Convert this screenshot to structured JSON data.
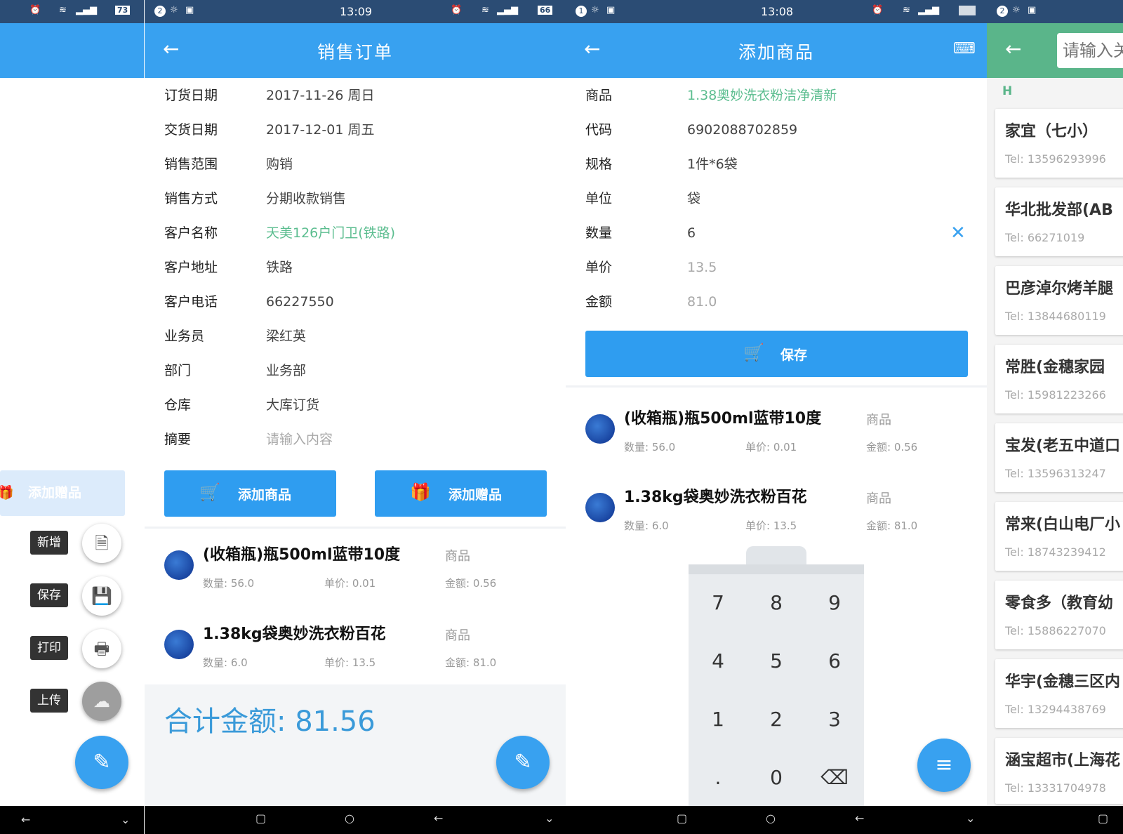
{
  "status": {
    "p1_battery": "73",
    "p2_notif": "2",
    "p2_time": "13:09",
    "p2_battery": "66",
    "p3_notif": "1",
    "p3_time": "13:08",
    "p4_notif": "2"
  },
  "p1": {
    "add_gift_ghost": "添加赠品",
    "fab_menu": [
      {
        "label": "新增",
        "icon": "new-document-icon"
      },
      {
        "label": "保存",
        "icon": "save-icon"
      },
      {
        "label": "打印",
        "icon": "print-icon"
      },
      {
        "label": "上传",
        "icon": "cloud-upload-icon"
      }
    ]
  },
  "p2": {
    "title": "销售订单",
    "fields": [
      {
        "label": "订货日期",
        "value": "2017-11-26 周日"
      },
      {
        "label": "交货日期",
        "value": "2017-12-01 周五"
      },
      {
        "label": "销售范围",
        "value": "购销"
      },
      {
        "label": "销售方式",
        "value": "分期收款销售"
      },
      {
        "label": "客户名称",
        "value": "天美126户门卫(铁路)"
      },
      {
        "label": "客户地址",
        "value": "铁路"
      },
      {
        "label": "客户电话",
        "value": "66227550"
      },
      {
        "label": "业务员",
        "value": "梁红英"
      },
      {
        "label": "部门",
        "value": "业务部"
      },
      {
        "label": "仓库",
        "value": "大库订货"
      },
      {
        "label": "摘要",
        "value": "请输入内容"
      }
    ],
    "add_goods_btn": "添加商品",
    "add_gift_btn": "添加赠品",
    "items": [
      {
        "name": "(收箱瓶)瓶500ml蓝带10度",
        "tag": "商品",
        "qty": "数量: 56.0",
        "price": "单价: 0.01",
        "amount": "金额: 0.56"
      },
      {
        "name": "1.38kg袋奥妙洗衣粉百花",
        "tag": "商品",
        "qty": "数量: 6.0",
        "price": "单价: 13.5",
        "amount": "金额: 81.0"
      }
    ],
    "total": "合计金额: 81.56"
  },
  "p3": {
    "title": "添加商品",
    "fields": [
      {
        "label": "商品",
        "value": "1.38奥妙洗衣粉洁净清新"
      },
      {
        "label": "代码",
        "value": "6902088702859"
      },
      {
        "label": "规格",
        "value": "1件*6袋"
      },
      {
        "label": "单位",
        "value": "袋"
      },
      {
        "label": "数量",
        "value": "6"
      },
      {
        "label": "单价",
        "value": "13.5"
      },
      {
        "label": "金额",
        "value": "81.0"
      }
    ],
    "save_btn": "保存",
    "items": [
      {
        "name": "(收箱瓶)瓶500ml蓝带10度",
        "tag": "商品",
        "qty": "数量: 56.0",
        "price": "单价: 0.01",
        "amount": "金额: 0.56"
      },
      {
        "name": "1.38kg袋奥妙洗衣粉百花",
        "tag": "商品",
        "qty": "数量: 6.0",
        "price": "单价: 13.5",
        "amount": "金额: 81.0"
      }
    ],
    "keys": [
      "7",
      "8",
      "9",
      "4",
      "5",
      "6",
      "1",
      "2",
      "3",
      ".",
      "0",
      "⌫"
    ]
  },
  "p4": {
    "search_placeholder": "请输入关",
    "section": "H",
    "customers": [
      {
        "name": "家宜（七小）",
        "tel": "Tel:  13596293996"
      },
      {
        "name": "华北批发部(AB",
        "tel": "Tel:  66271019"
      },
      {
        "name": "巴彦淖尔烤羊腿",
        "tel": "Tel:  13844680119"
      },
      {
        "name": "常胜(金穗家园",
        "tel": "Tel:  15981223266"
      },
      {
        "name": "宝发(老五中道口",
        "tel": "Tel:  13596313247"
      },
      {
        "name": "常来(白山电厂小",
        "tel": "Tel:  18743239412"
      },
      {
        "name": "零食多（教育幼",
        "tel": "Tel:  15886227070"
      },
      {
        "name": "华宇(金穗三区内",
        "tel": "Tel:  13294438769"
      },
      {
        "name": "涵宝超市(上海花",
        "tel": "Tel:  13331704978"
      }
    ]
  }
}
